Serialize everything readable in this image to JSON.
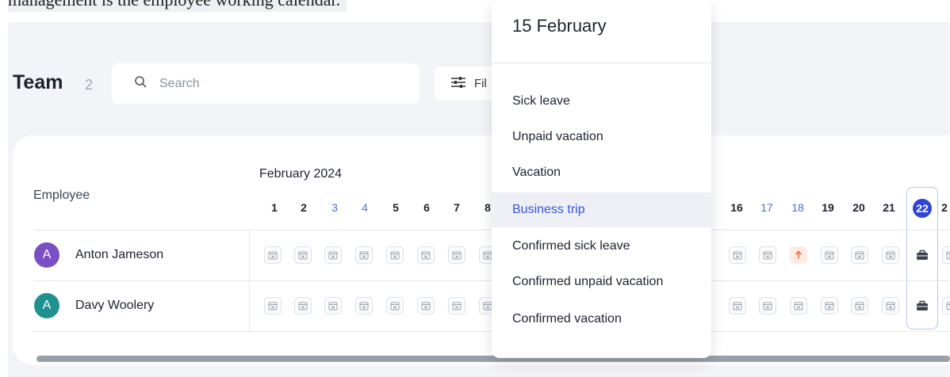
{
  "caption": "management is the employee working calendar.",
  "team": {
    "title": "Team",
    "count": "2"
  },
  "search": {
    "placeholder": "Search"
  },
  "filter": {
    "label": "Fil"
  },
  "calendar": {
    "employee_header": "Employee",
    "month": "February 2024",
    "days_left": [
      "1",
      "2",
      "3",
      "4",
      "5",
      "6",
      "7",
      "8"
    ],
    "days_right": [
      "16",
      "17",
      "18",
      "19",
      "20",
      "21"
    ],
    "today": "22",
    "next_partial": "2"
  },
  "employees": [
    {
      "initial": "A",
      "name": "Anton Jameson",
      "avatar_color": "#7a4fc4"
    },
    {
      "initial": "A",
      "name": "Davy Woolery",
      "avatar_color": "#1f9190"
    }
  ],
  "dropdown": {
    "title": "15 February",
    "items": [
      "Sick leave",
      "Unpaid vacation",
      "Vacation",
      "Business trip",
      "Confirmed sick leave",
      "Confirmed unpaid vacation",
      "Confirmed vacation"
    ],
    "selected": "Business trip"
  },
  "colors": {
    "accent": "#2e45d6",
    "weekend_text": "#4a6cd4",
    "sick_bg": "#fdece4",
    "sick_arrow": "#f26a3d"
  },
  "icons": {
    "search": "search-icon",
    "filter": "sliders-icon",
    "day_cell": "calendar-x-icon",
    "sick": "arrow-up-icon",
    "trip": "briefcase-icon"
  }
}
